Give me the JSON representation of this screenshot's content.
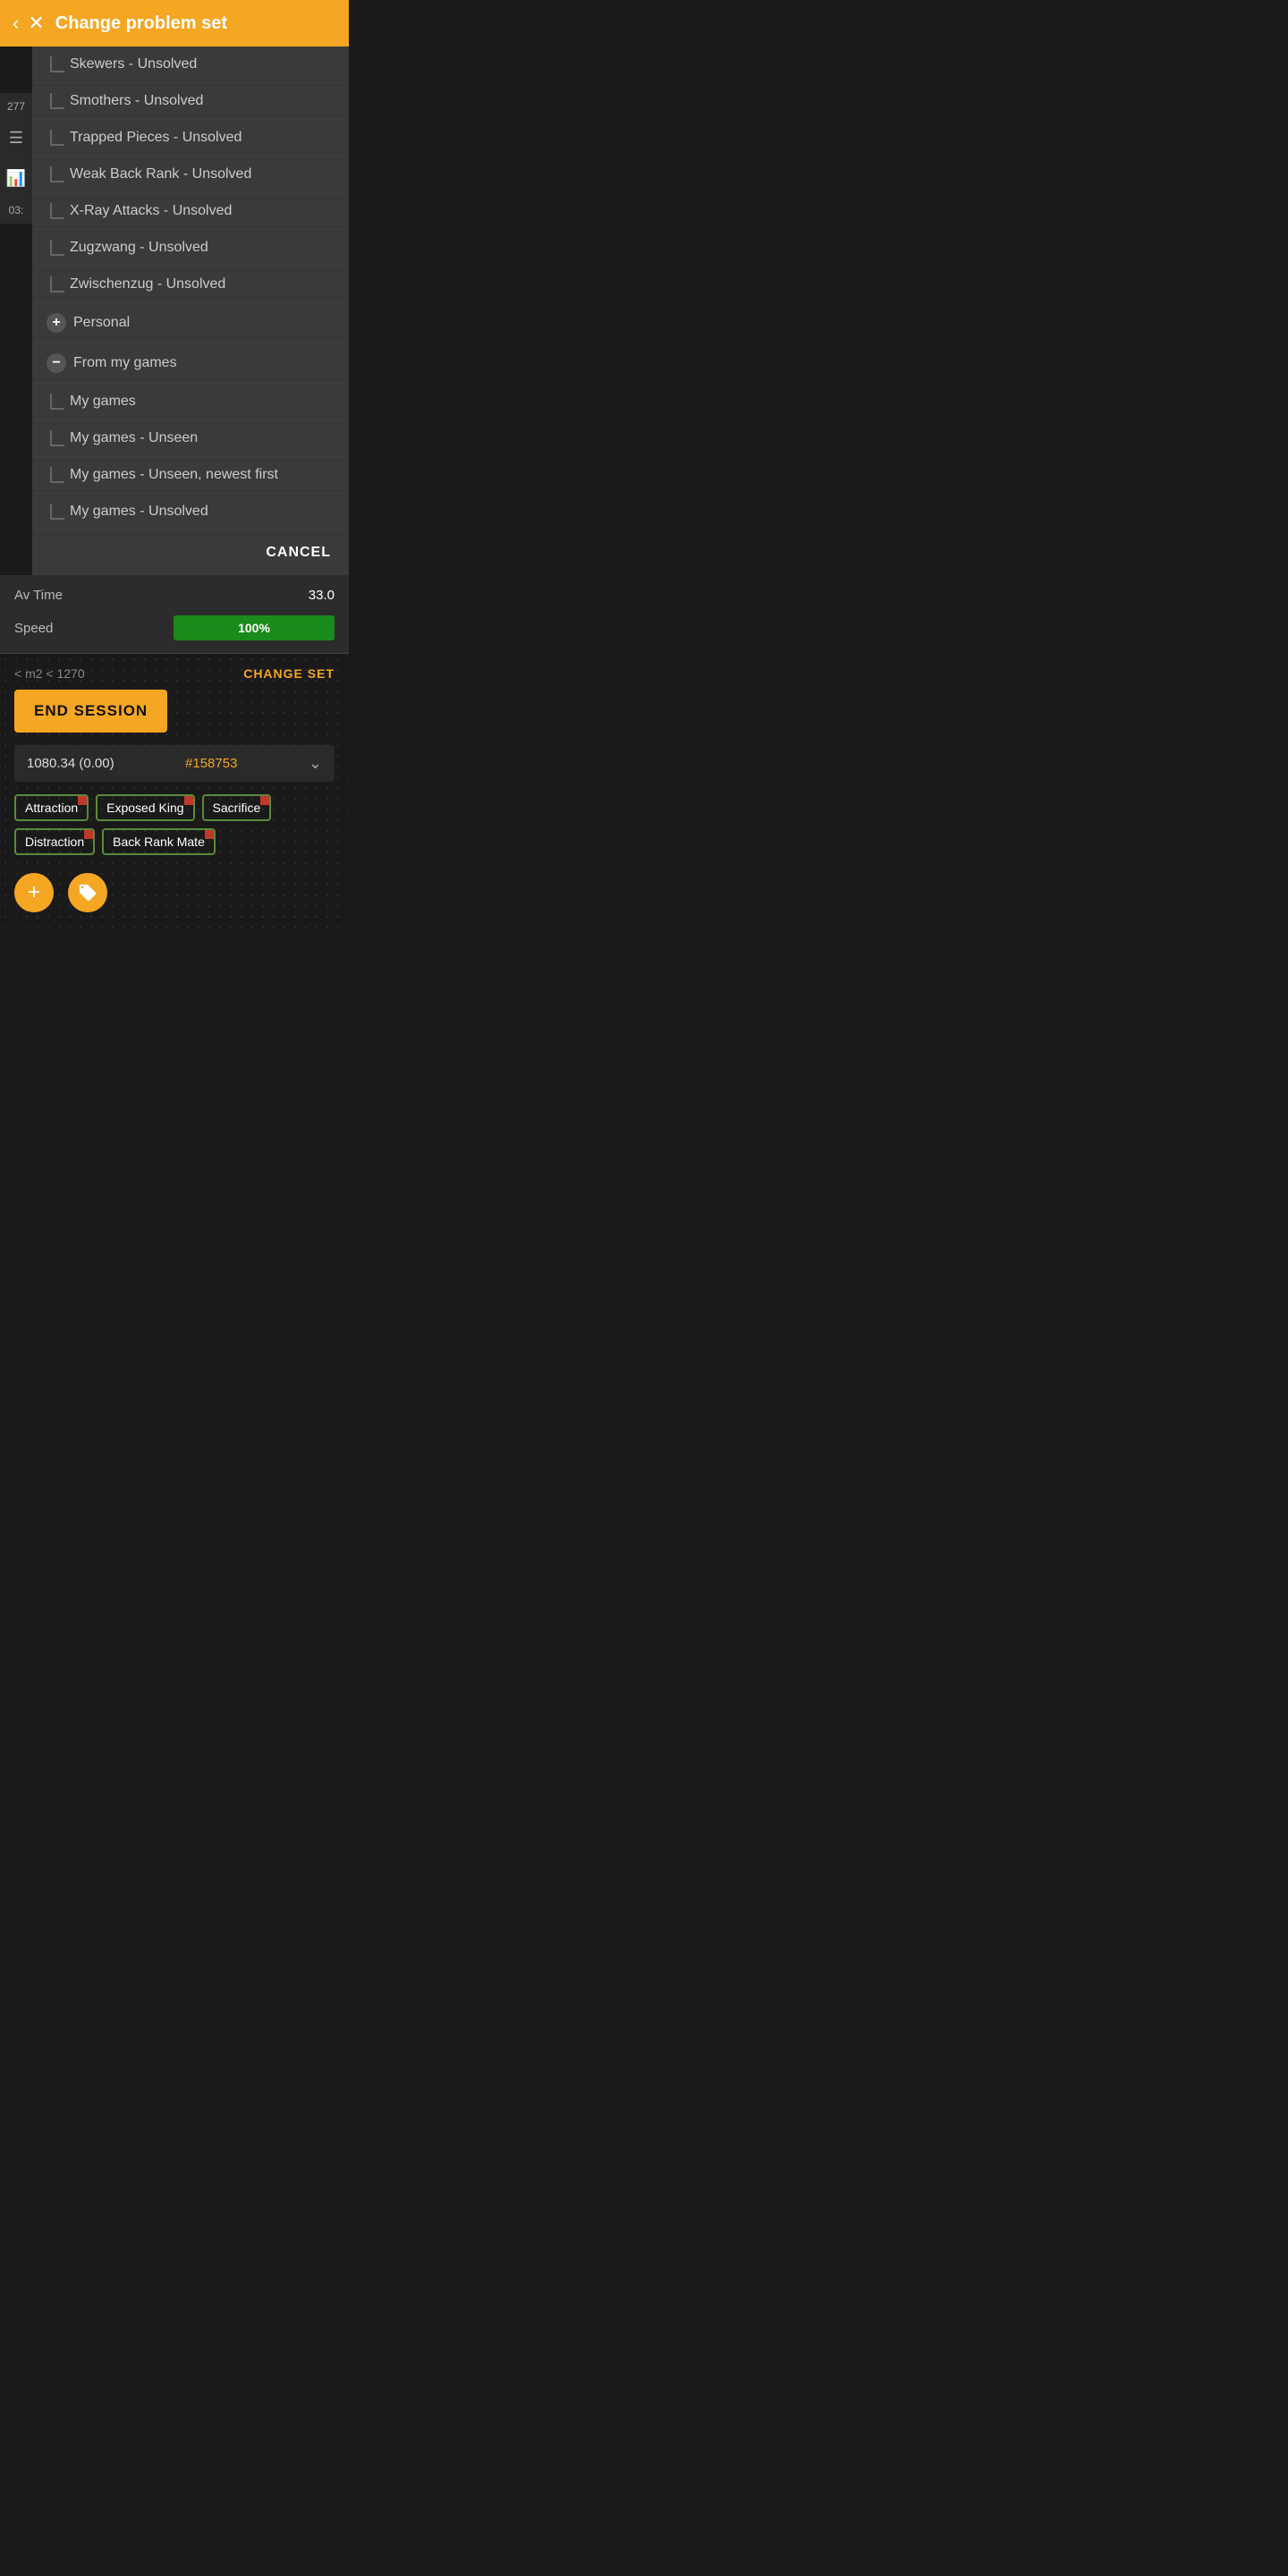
{
  "header": {
    "title": "Change problem set",
    "back_label": "←",
    "close_label": "✕"
  },
  "sidebar": {
    "number": "277",
    "number2": "03:",
    "icons": [
      "☰",
      "📊"
    ]
  },
  "dropdown": {
    "items": [
      {
        "type": "sub",
        "label": "Skewers - Unsolved"
      },
      {
        "type": "sub",
        "label": "Smothers - Unsolved"
      },
      {
        "type": "sub",
        "label": "Trapped Pieces - Unsolved"
      },
      {
        "type": "sub",
        "label": "Weak Back Rank - Unsolved"
      },
      {
        "type": "sub",
        "label": "X-Ray Attacks - Unsolved"
      },
      {
        "type": "sub",
        "label": "Zugzwang - Unsolved"
      },
      {
        "type": "sub",
        "label": "Zwischenzug - Unsolved"
      }
    ],
    "personal": {
      "label": "Personal",
      "toggle": "+"
    },
    "from_my_games": {
      "label": "From my games",
      "toggle": "−",
      "sub_items": [
        "My games",
        "My games - Unseen",
        "My games - Unseen, newest first",
        "My games - Unsolved"
      ]
    },
    "cancel_label": "CANCEL"
  },
  "stats": {
    "av_time_label": "Av Time",
    "av_time_value": "33.0",
    "speed_label": "Speed",
    "speed_value": "100%"
  },
  "bottom": {
    "set_info": "< m2 < 1270",
    "change_set_label": "CHANGE SET",
    "end_session_label": "END SESSION",
    "game_info": "1080.34 (0.00)",
    "game_link": "#158753",
    "tags": [
      "Attraction",
      "Exposed King",
      "Sacrifice",
      "Distraction",
      "Back Rank Mate"
    ]
  },
  "actions": {
    "add_label": "+",
    "tag_icon": "🏷"
  }
}
